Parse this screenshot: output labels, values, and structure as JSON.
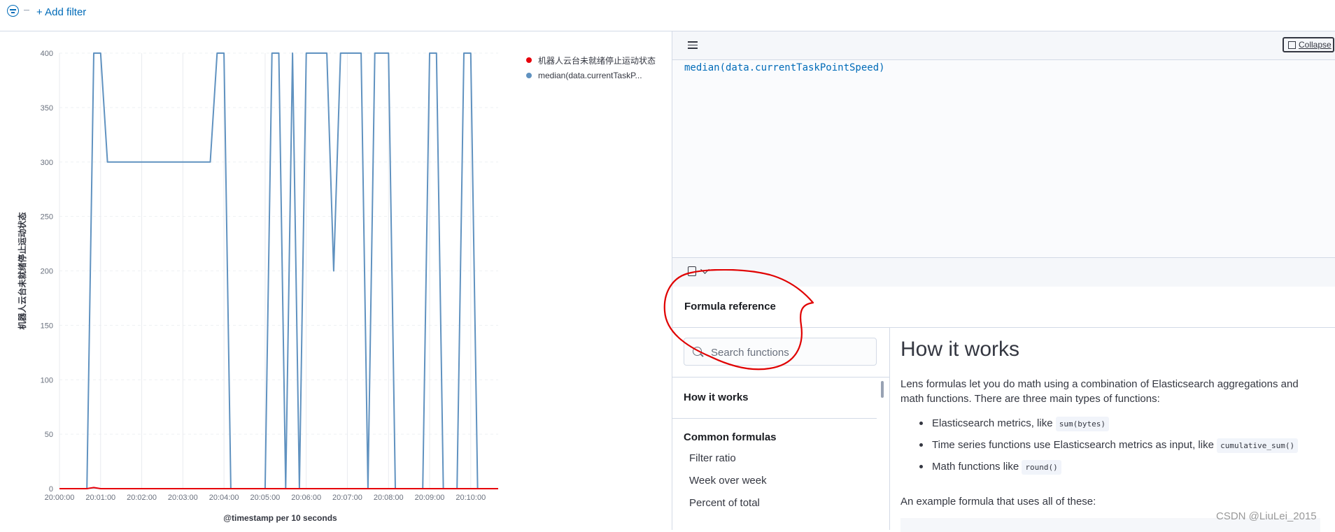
{
  "filter_bar": {
    "add_filter_label": "+ Add filter"
  },
  "chart_data": {
    "type": "line",
    "ylabel": "机器人云台未就绪停止运动状态",
    "xlabel": "@timestamp per 10 seconds",
    "ylim": [
      0,
      400
    ],
    "y_ticks": [
      "0",
      "50",
      "100",
      "150",
      "200",
      "250",
      "300",
      "350",
      "400"
    ],
    "x_ticks": [
      "20:00:00",
      "20:01:00",
      "20:02:00",
      "20:03:00",
      "20:04:00",
      "20:05:00",
      "20:06:00",
      "20:07:00",
      "20:08:00",
      "20:09:00",
      "20:10:00"
    ],
    "grid": true,
    "legend_position": "top-right",
    "series": [
      {
        "name": "机器人云台未就绪停止运动状态",
        "color": "#e7000b",
        "x": [
          0,
          40,
          50,
          60,
          70,
          80,
          130,
          140,
          150,
          160,
          640
        ],
        "y": [
          0,
          0,
          1,
          0,
          0,
          0,
          0,
          0,
          0,
          0,
          0
        ]
      },
      {
        "name": "median(data.currentTaskPointSpeed)",
        "color": "#6092c0",
        "x": [
          0,
          10,
          20,
          30,
          40,
          50,
          60,
          70,
          80,
          90,
          100,
          110,
          120,
          130,
          140,
          150,
          160,
          170,
          180,
          190,
          200,
          210,
          220,
          230,
          240,
          250,
          260,
          270,
          280,
          290,
          300,
          310,
          320,
          330,
          340,
          350,
          360,
          370,
          380,
          390,
          400,
          410,
          420,
          430,
          440,
          450,
          460,
          470,
          480,
          490,
          500,
          510,
          520,
          530,
          540,
          550,
          560,
          570,
          580,
          590,
          600,
          610,
          620,
          630,
          640
        ],
        "y": [
          0,
          0,
          0,
          0,
          0,
          400,
          400,
          300,
          300,
          300,
          300,
          300,
          300,
          300,
          300,
          300,
          300,
          300,
          300,
          300,
          300,
          300,
          300,
          400,
          400,
          0,
          0,
          0,
          0,
          0,
          0,
          400,
          400,
          0,
          400,
          0,
          400,
          400,
          400,
          400,
          200,
          400,
          400,
          400,
          400,
          0,
          400,
          400,
          400,
          0,
          0,
          0,
          0,
          0,
          400,
          400,
          0,
          0,
          0,
          400,
          400,
          0,
          0,
          0,
          0
        ]
      }
    ]
  },
  "editor": {
    "collapse_label": "Collapse",
    "formula": "median(data.currentTaskPointSpeed)"
  },
  "reference": {
    "title": "Formula reference",
    "search_placeholder": "Search functions",
    "sections": [
      {
        "heading": "How it works",
        "items": []
      },
      {
        "heading": "Common formulas",
        "items": [
          "Filter ratio",
          "Week over week",
          "Percent of total"
        ]
      }
    ],
    "content": {
      "title": "How it works",
      "intro": "Lens formulas let you do math using a combination of Elasticsearch aggregations and math functions. There are three main types of functions:",
      "bullets": [
        {
          "text": "Elasticsearch metrics, like ",
          "code": "sum(bytes)"
        },
        {
          "text": "Time series functions use Elasticsearch metrics as input, like ",
          "code": "cumulative_sum()"
        },
        {
          "text": "Math functions like ",
          "code": "round()"
        }
      ],
      "example_label": "An example formula that uses all of these:"
    }
  },
  "watermark": "CSDN @LiuLei_2015",
  "colors": {
    "accent": "#006bb8",
    "annotation": "#e00000"
  }
}
